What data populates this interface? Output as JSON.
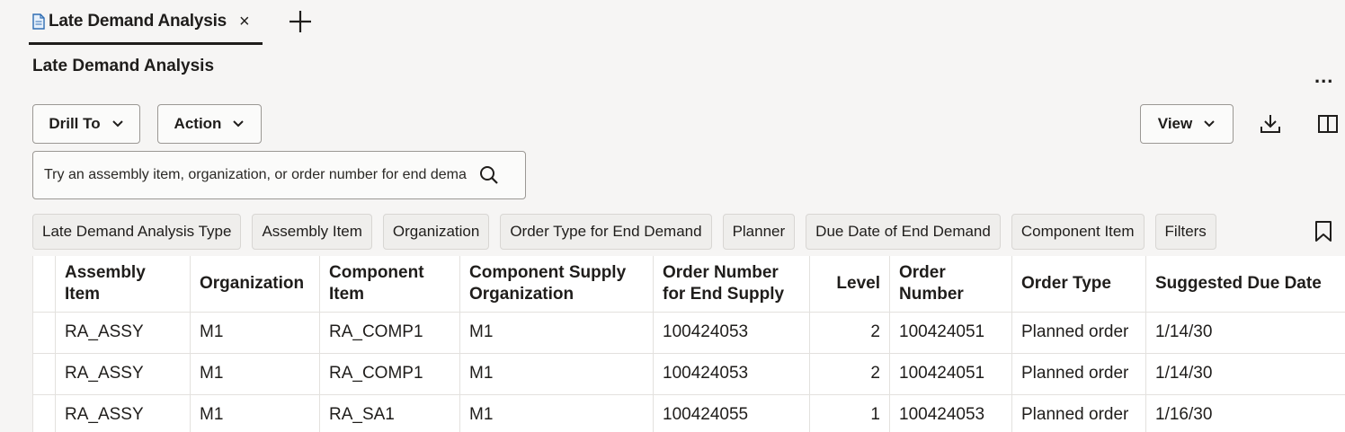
{
  "tab": {
    "label": "Late Demand Analysis",
    "close": "×"
  },
  "page": {
    "title": "Late Demand Analysis",
    "more": "..."
  },
  "toolbar": {
    "drill_to": "Drill To",
    "action": "Action",
    "view": "View"
  },
  "search": {
    "placeholder": "Try an assembly item, organization, or order number for end demand"
  },
  "chips": [
    "Late Demand Analysis Type",
    "Assembly Item",
    "Organization",
    "Order Type for End Demand",
    "Planner",
    "Due Date of End Demand",
    "Component Item",
    "Filters"
  ],
  "table": {
    "columns": [
      "Assembly Item",
      "Organization",
      "Component Item",
      "Component Supply Organization",
      "Order Number for End Supply",
      "Level",
      "Order Number",
      "Order Type",
      "Suggested Due Date"
    ],
    "rows": [
      [
        "RA_ASSY",
        "M1",
        "RA_COMP1",
        "M1",
        "100424053",
        "2",
        "100424051",
        "Planned order",
        "1/14/30"
      ],
      [
        "RA_ASSY",
        "M1",
        "RA_COMP1",
        "M1",
        "100424053",
        "2",
        "100424051",
        "Planned order",
        "1/14/30"
      ],
      [
        "RA_ASSY",
        "M1",
        "RA_SA1",
        "M1",
        "100424055",
        "1",
        "100424053",
        "Planned order",
        "1/16/30"
      ]
    ]
  },
  "icons": [
    "document-icon",
    "close-icon",
    "plus-icon",
    "chevron-down-icon",
    "download-icon",
    "columns-icon",
    "search-icon",
    "bookmark-icon",
    "more-icon"
  ]
}
